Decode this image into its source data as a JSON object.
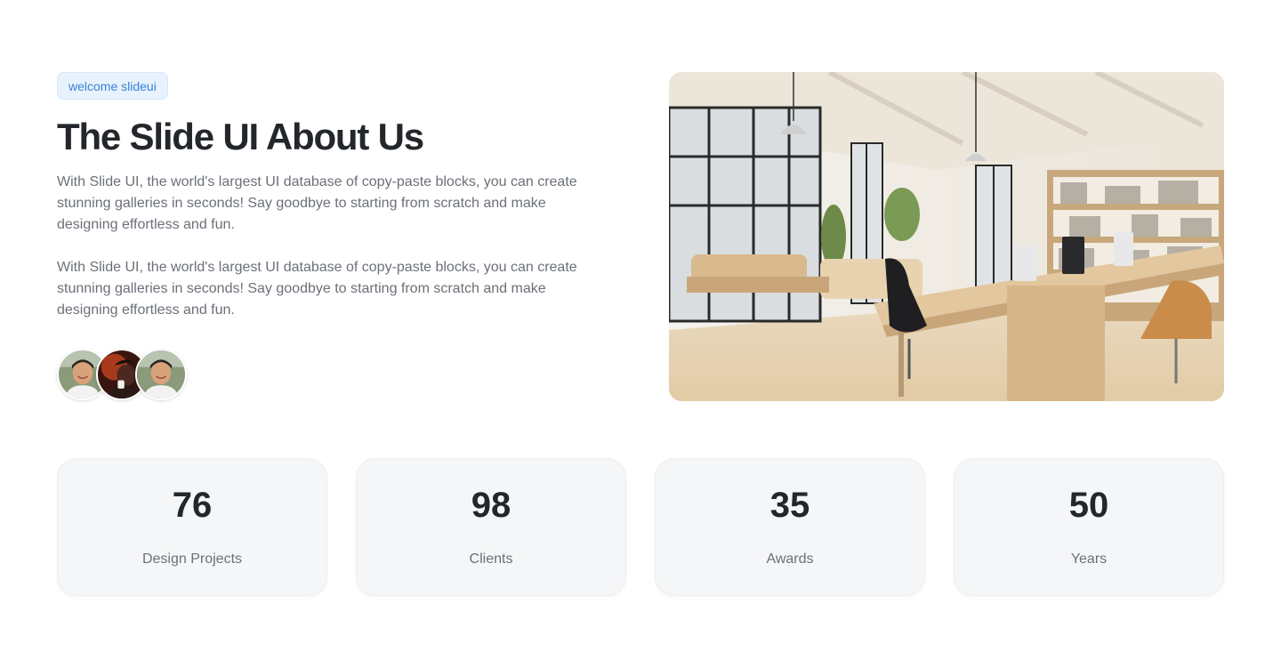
{
  "badge": "welcome slideui",
  "title": "The Slide UI About Us",
  "paragraphs": [
    "With Slide UI, the world's largest UI database of copy-paste blocks, you can create stunning galleries in seconds! Say goodbye to starting from scratch and make designing effortless and fun.",
    "With Slide UI, the world's largest UI database of copy-paste blocks, you can create stunning galleries in seconds! Say goodbye to starting from scratch and make designing effortless and fun."
  ],
  "avatars": [
    {
      "icon": "person-avatar-1"
    },
    {
      "icon": "person-avatar-2"
    },
    {
      "icon": "person-avatar-3"
    }
  ],
  "hero_image": {
    "icon": "office-interior-image"
  },
  "stats": [
    {
      "value": "76",
      "label": "Design Projects"
    },
    {
      "value": "98",
      "label": "Clients"
    },
    {
      "value": "35",
      "label": "Awards"
    },
    {
      "value": "50",
      "label": "Years"
    }
  ],
  "colors": {
    "badge_bg": "#e7f2fd",
    "badge_text": "#3b82d6",
    "heading": "#23272b",
    "body_text": "#6b7078",
    "card_bg": "#f5f6f7"
  }
}
